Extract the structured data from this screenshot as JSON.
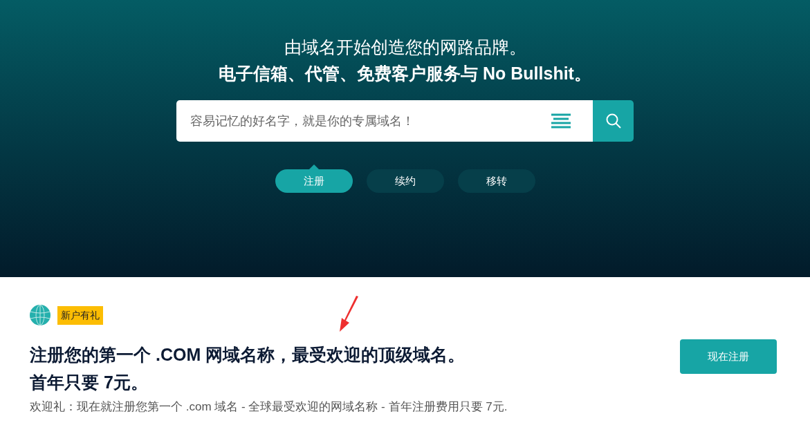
{
  "hero": {
    "title": "由域名开始创造您的网路品牌。",
    "subtitle": "电子信箱、代管、免费客户服务与 No Bullshit。"
  },
  "search": {
    "placeholder": "容易记忆的好名字，就是你的专属域名！"
  },
  "tabs": [
    {
      "label": "注册",
      "selected": true
    },
    {
      "label": "续约",
      "selected": false
    },
    {
      "label": "移转",
      "selected": false
    }
  ],
  "promo": {
    "badge": "新户有礼",
    "heading_lines": [
      "注册您的第一个 .COM 网域名称，最受欢迎的顶级域名。",
      "首年只要 7元。"
    ],
    "description": "欢迎礼：现在就注册您第一个 .com 域名 - 全球最受欢迎的网域名称 - 首年注册费用只要 7元.",
    "button": "现在注册"
  }
}
